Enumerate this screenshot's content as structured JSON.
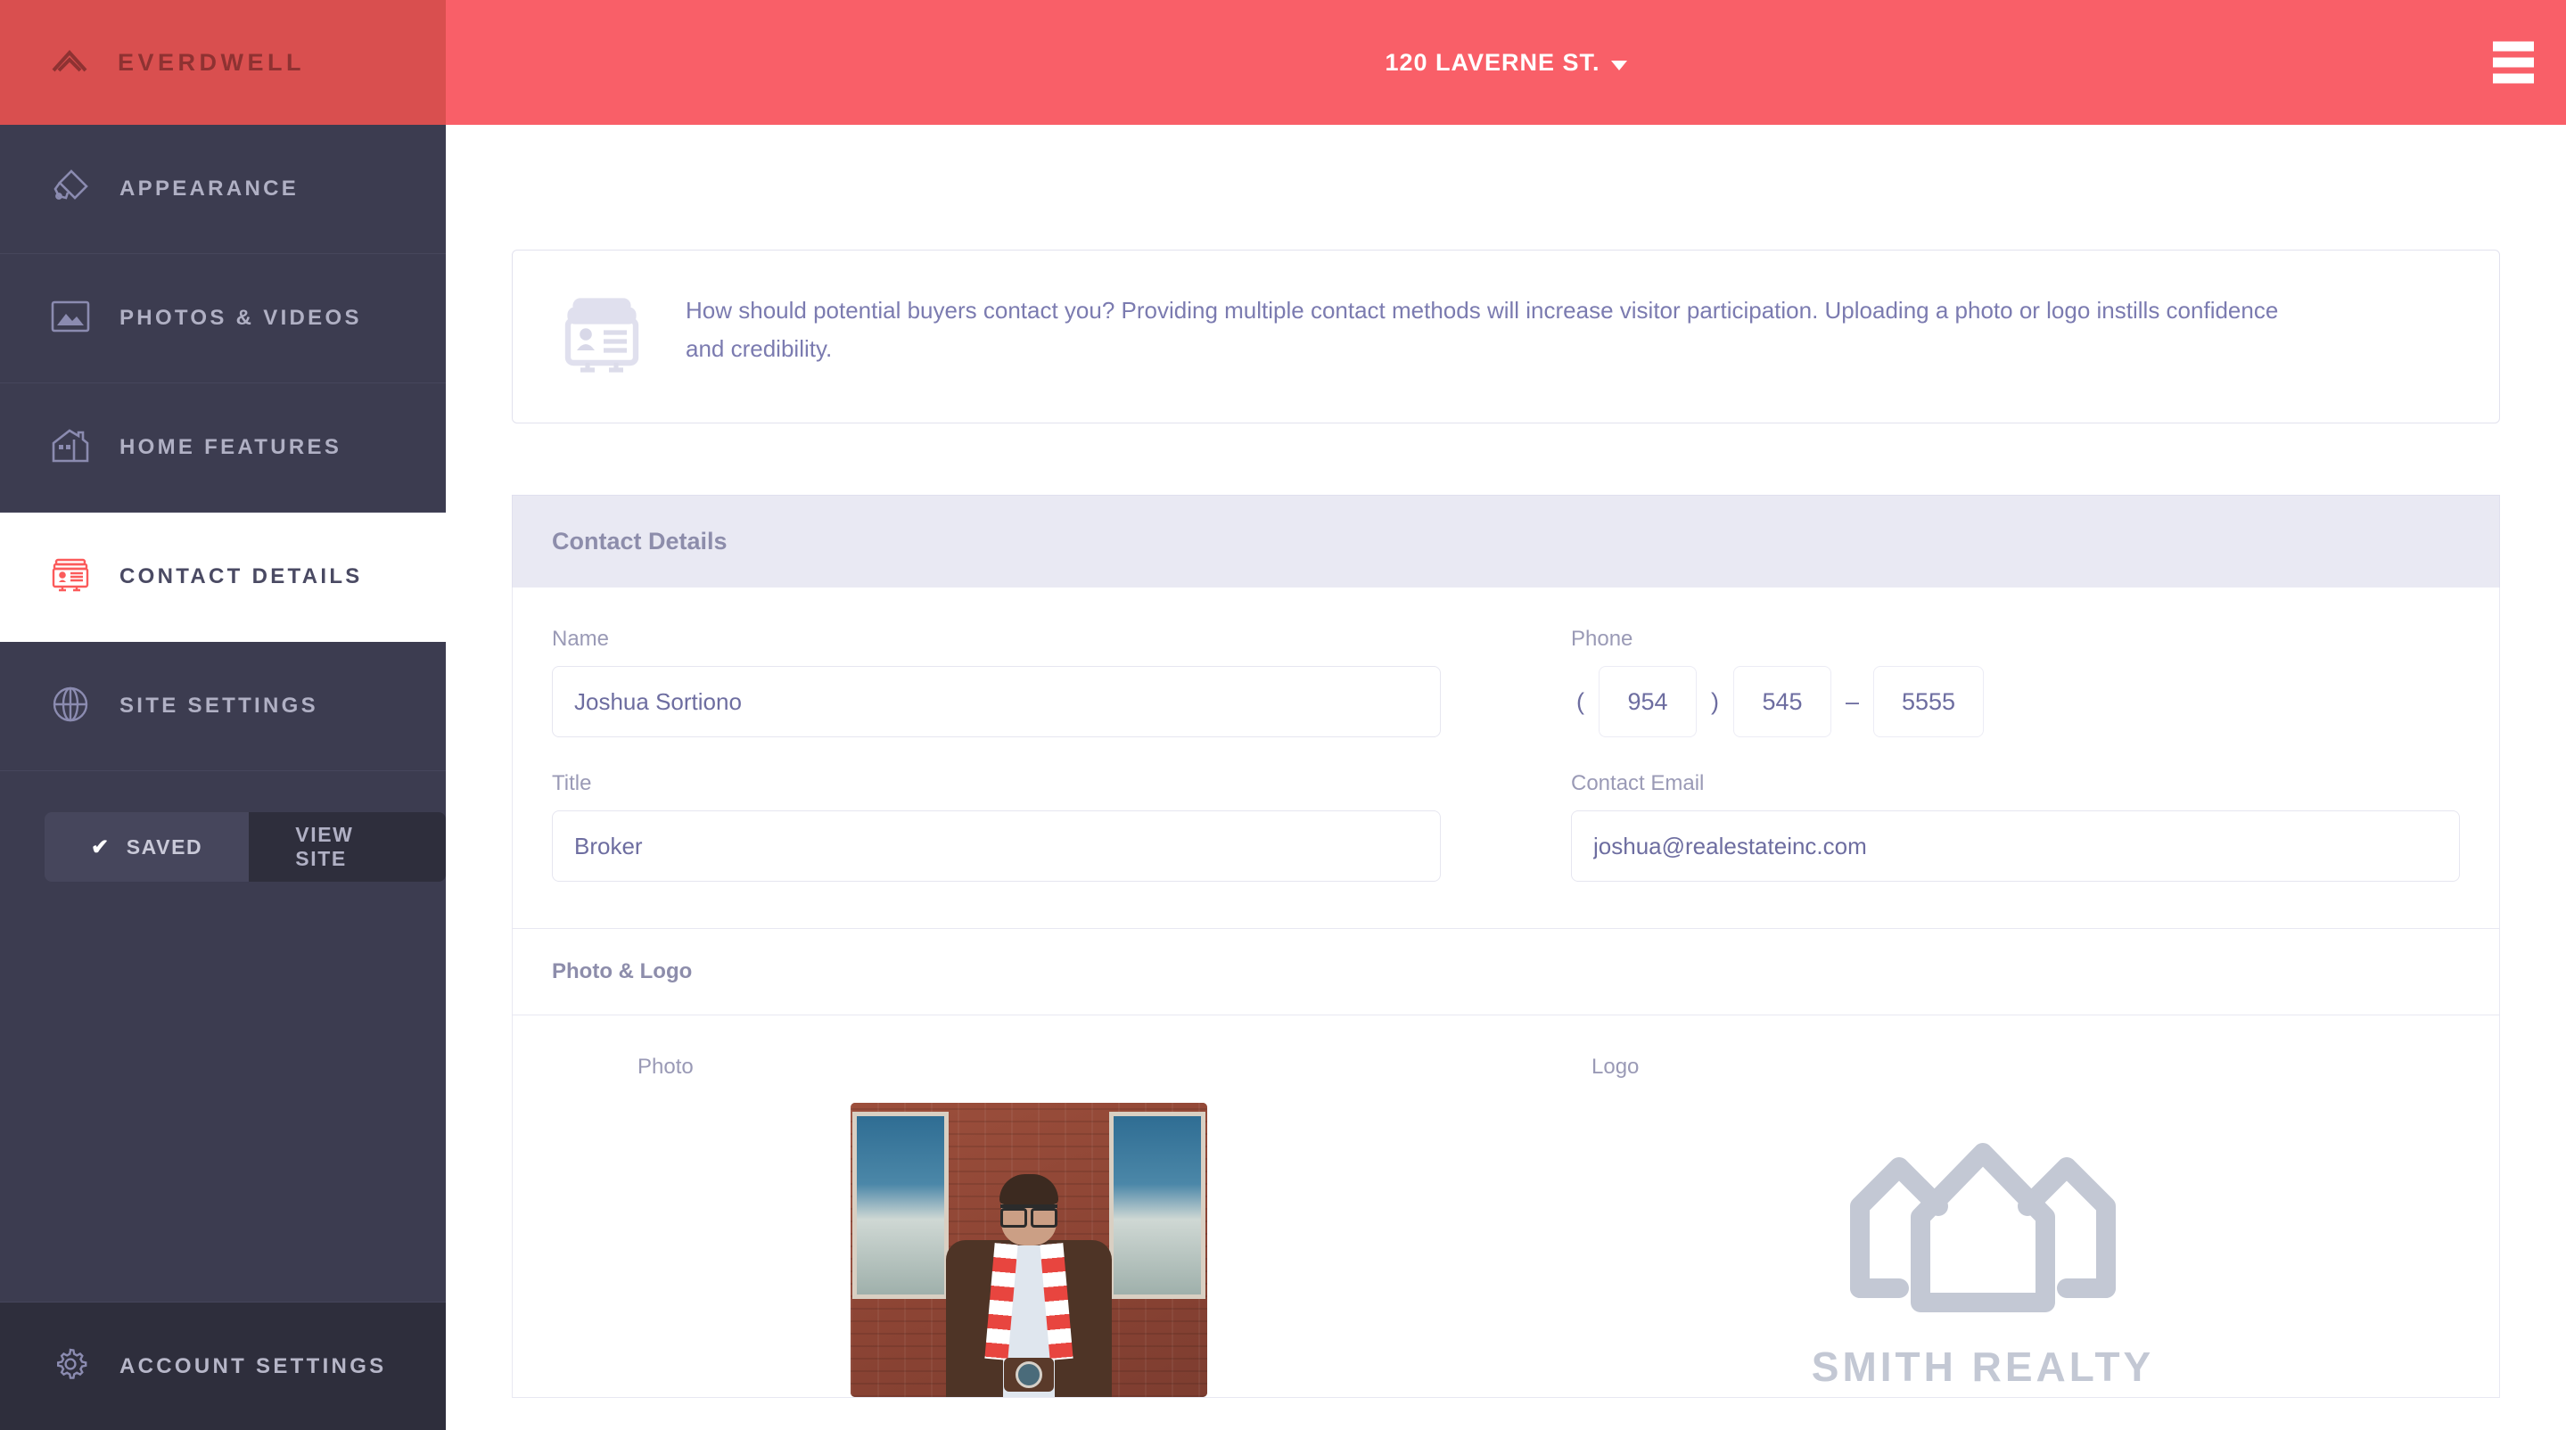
{
  "sidebar": {
    "brand": {
      "name": "EVERDWELL",
      "icon": "chevron-up-roof-icon"
    },
    "items": [
      {
        "label": "APPEARANCE",
        "icon": "paint-brush-icon",
        "active": false
      },
      {
        "label": "PHOTOS & VIDEOS",
        "icon": "image-icon",
        "active": false
      },
      {
        "label": "HOME FEATURES",
        "icon": "house-icon",
        "active": false
      },
      {
        "label": "CONTACT DETAILS",
        "icon": "contact-card-icon",
        "active": true
      },
      {
        "label": "SITE SETTINGS",
        "icon": "globe-icon",
        "active": false
      }
    ],
    "saved_button": {
      "label": "SAVED",
      "icon": "check-icon"
    },
    "view_site_button": {
      "label": "VIEW SITE"
    },
    "account_settings": {
      "label": "ACCOUNT SETTINGS",
      "icon": "gear-icon"
    }
  },
  "topbar": {
    "address": "120 LAVERNE ST.",
    "caret_icon": "chevron-down-icon",
    "menu_icon": "hamburger-menu-icon"
  },
  "info_banner": {
    "icon": "contact-card-icon",
    "text": "How should potential buyers contact you? Providing multiple contact methods will increase visitor participation. Uploading a photo or logo instills confidence and credibility."
  },
  "panel": {
    "title": "Contact Details",
    "fields": {
      "name": {
        "label": "Name",
        "value": "Joshua Sortiono",
        "placeholder": "Name"
      },
      "title": {
        "label": "Title",
        "value": "Broker",
        "placeholder": "Title"
      },
      "phone": {
        "label": "Phone",
        "open_paren": "(",
        "close_paren": ")",
        "dash": "–",
        "area": "954",
        "prefix": "545",
        "line": "5555"
      },
      "email": {
        "label": "Contact Email",
        "value": "joshua@realestateinc.com",
        "placeholder": "Contact Email"
      }
    },
    "media": {
      "section_title": "Photo & Logo",
      "photo_label": "Photo",
      "logo_label": "Logo",
      "logo_text": "SMITH REALTY"
    }
  },
  "colors": {
    "brand_red": "#d94f4f",
    "topbar_red": "#f95f68",
    "sidebar_dark": "#3c3c50",
    "sidebar_darker": "#2e2e3c",
    "accent_text": "#7b7bb0",
    "panel_head": "#e9e9f3"
  }
}
